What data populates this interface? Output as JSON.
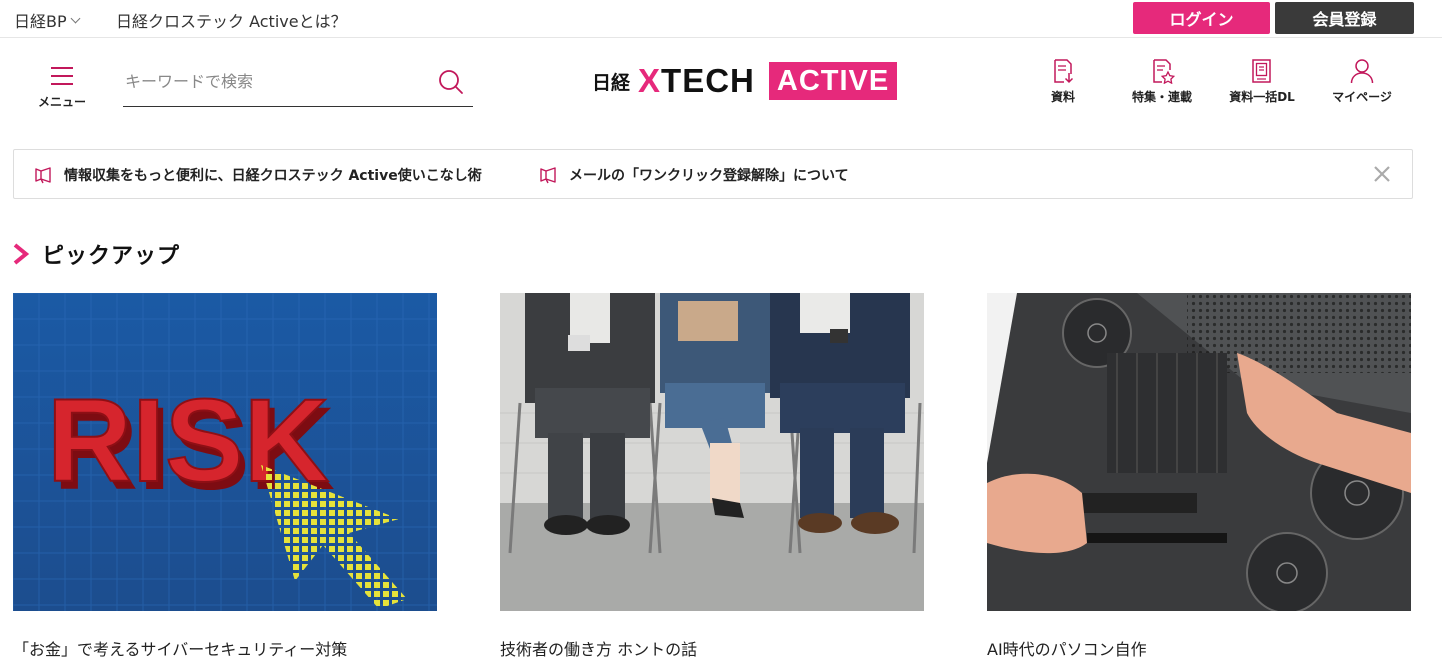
{
  "topbar": {
    "brand": "日経BP",
    "about": "日経クロステック Activeとは？",
    "login": "ログイン",
    "register": "会員登録"
  },
  "header": {
    "menu_label": "メニュー",
    "search_placeholder": "キーワードで検索",
    "logo": {
      "nikkei": "日経",
      "xtech_x": "X",
      "xtech_rest": "TECH",
      "active": "ACTIVE"
    },
    "nav": [
      {
        "label": "資料",
        "icon": "document-download-icon"
      },
      {
        "label": "特集・連載",
        "icon": "document-star-icon"
      },
      {
        "label": "資料一括DL",
        "icon": "documents-stack-icon"
      },
      {
        "label": "マイページ",
        "icon": "user-icon"
      }
    ]
  },
  "notices": [
    {
      "text": "情報収集をもっと便利に、日経クロステック Active使いこなし術",
      "icon": "megaphone-icon"
    },
    {
      "text": "メールの「ワンクリック登録解除」について",
      "icon": "megaphone-icon"
    }
  ],
  "section": {
    "title": "ピックアップ"
  },
  "cards": [
    {
      "title": "「お金」で考えるサイバーセキュリティー対策",
      "image": "risk-arrow-image"
    },
    {
      "title": "技術者の働き方 ホントの話",
      "image": "seated-people-image"
    },
    {
      "title": "AI時代のパソコン自作",
      "image": "pc-build-image"
    }
  ],
  "colors": {
    "accent": "#e6297b",
    "dark": "#3a3a3a"
  }
}
